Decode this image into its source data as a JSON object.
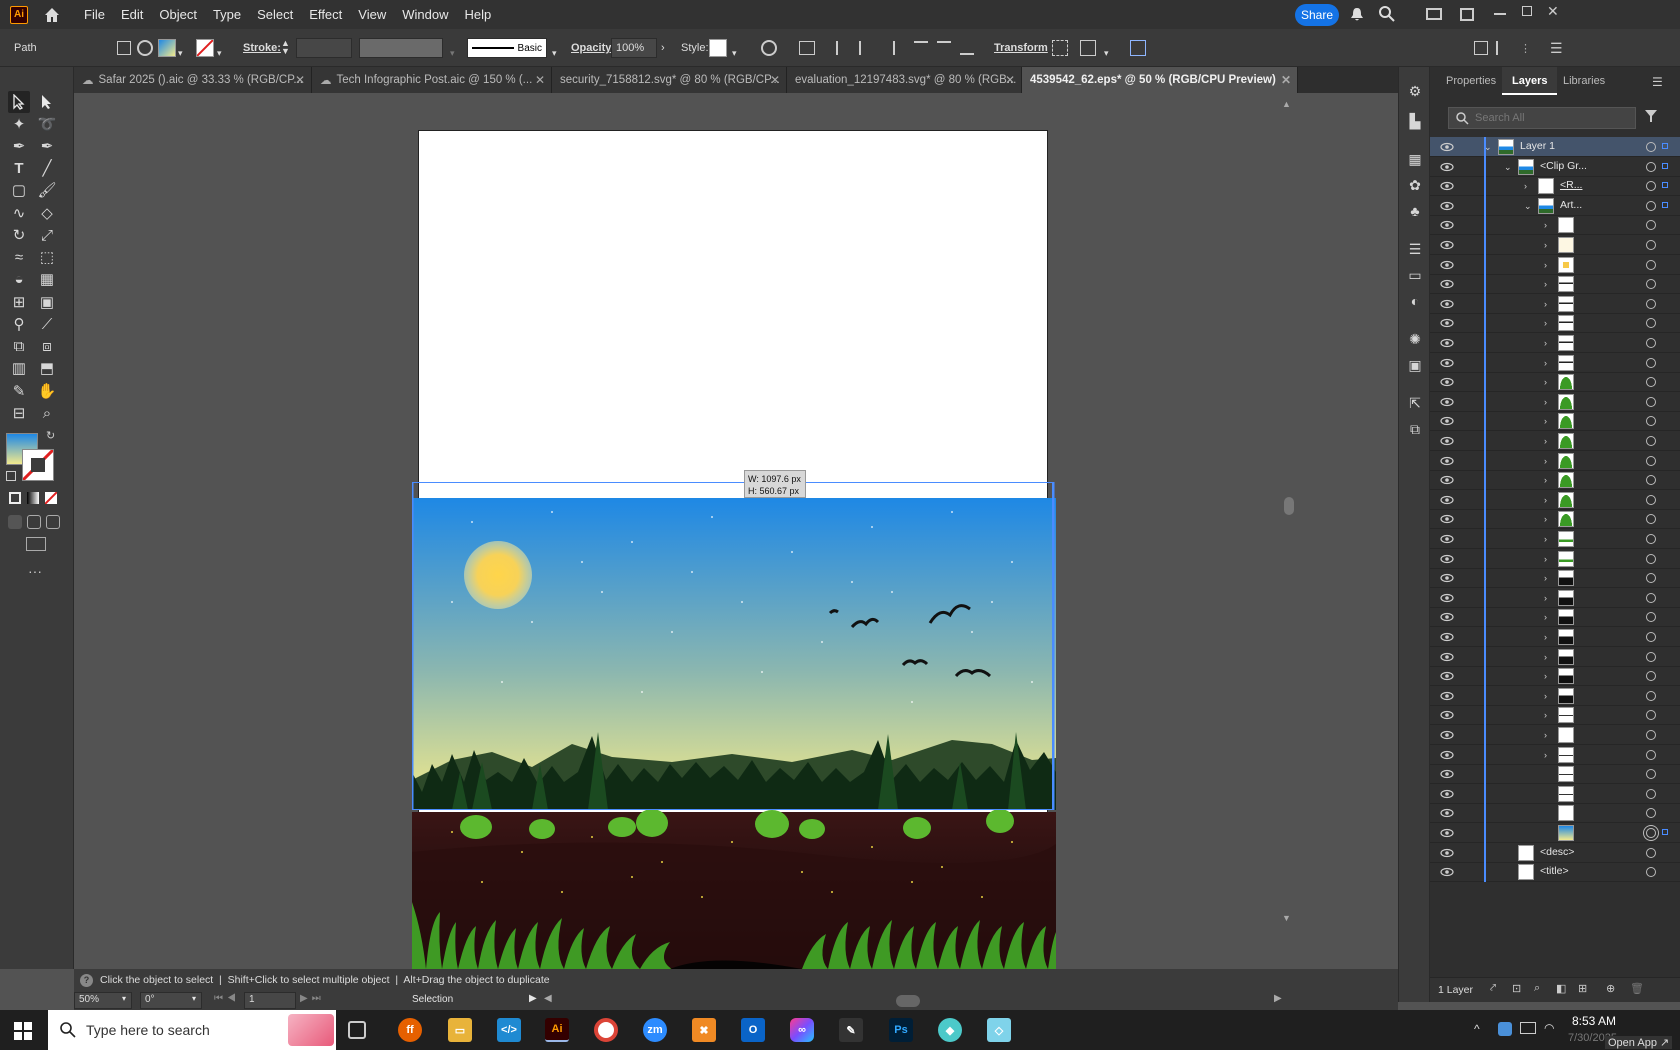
{
  "app": {
    "logo": "Ai",
    "share_label": "Share"
  },
  "menu": [
    "File",
    "Edit",
    "Object",
    "Type",
    "Select",
    "Effect",
    "View",
    "Window",
    "Help"
  ],
  "control": {
    "selection_type": "Path",
    "stroke_label": "Stroke:",
    "brush_label": "Basic",
    "opacity_label": "Opacity:",
    "opacity_value": "100%",
    "style_label": "Style:",
    "transform_label": "Transform"
  },
  "tabs": [
    {
      "label": "Safar 2025 ().aic @ 33.33 % (RGB/CP...",
      "cloud": true
    },
    {
      "label": "Tech Infographic Post.aic @ 150 % (...",
      "cloud": true
    },
    {
      "label": "security_7158812.svg* @ 80 % (RGB/CP..."
    },
    {
      "label": "evaluation_12197483.svg* @ 80 % (RGB..."
    },
    {
      "label": "4539542_62.eps* @ 50 % (RGB/CPU Preview)",
      "active": true
    }
  ],
  "canvas": {
    "dim_w": "W: 1097.6 px",
    "dim_h": "H: 560.67 px",
    "sky_top": "#1e88e5",
    "sky_bottom": "#f3ea8c"
  },
  "panel": {
    "tabs": [
      "Properties",
      "Layers",
      "Libraries"
    ],
    "active_tab": "Layers",
    "search_placeholder": "Search All",
    "layers": [
      {
        "name": "Layer 1",
        "level": 0,
        "thumb": "scene",
        "selected": true
      },
      {
        "name": "<Clip Gr...",
        "level": 1,
        "thumb": "scene"
      },
      {
        "name": "<R...",
        "level": 2,
        "thumb": "white",
        "underline": true
      },
      {
        "name": "Art...",
        "level": 2,
        "thumb": "scene"
      },
      {
        "name": "",
        "level": 3,
        "thumb": "white"
      },
      {
        "name": "",
        "level": 3,
        "thumb": "cream"
      },
      {
        "name": "",
        "level": 3,
        "thumb": "sun"
      },
      {
        "name": "",
        "level": 3,
        "thumb": "wave"
      },
      {
        "name": "",
        "level": 3,
        "thumb": "wave"
      },
      {
        "name": "",
        "level": 3,
        "thumb": "wave"
      },
      {
        "name": "",
        "level": 3,
        "thumb": "wave"
      },
      {
        "name": "",
        "level": 3,
        "thumb": "wave"
      },
      {
        "name": "",
        "level": 3,
        "thumb": "grass"
      },
      {
        "name": "",
        "level": 3,
        "thumb": "grass"
      },
      {
        "name": "",
        "level": 3,
        "thumb": "grass"
      },
      {
        "name": "",
        "level": 3,
        "thumb": "grass"
      },
      {
        "name": "",
        "level": 3,
        "thumb": "grass"
      },
      {
        "name": "",
        "level": 3,
        "thumb": "grass"
      },
      {
        "name": "",
        "level": 3,
        "thumb": "grass"
      },
      {
        "name": "",
        "level": 3,
        "thumb": "grass"
      },
      {
        "name": "",
        "level": 3,
        "thumb": "band"
      },
      {
        "name": "",
        "level": 3,
        "thumb": "band"
      },
      {
        "name": "",
        "level": 3,
        "thumb": "tree"
      },
      {
        "name": "",
        "level": 3,
        "thumb": "tree"
      },
      {
        "name": "",
        "level": 3,
        "thumb": "tree"
      },
      {
        "name": "",
        "level": 3,
        "thumb": "tree"
      },
      {
        "name": "",
        "level": 3,
        "thumb": "tree"
      },
      {
        "name": "",
        "level": 3,
        "thumb": "tree"
      },
      {
        "name": "",
        "level": 3,
        "thumb": "tree"
      },
      {
        "name": "",
        "level": 3,
        "thumb": "line"
      },
      {
        "name": "",
        "level": 3,
        "thumb": "white"
      },
      {
        "name": "",
        "level": 3,
        "thumb": "line"
      },
      {
        "name": "",
        "level": 3,
        "thumb": "line",
        "nochev": true
      },
      {
        "name": "",
        "level": 3,
        "thumb": "line",
        "nochev": true
      },
      {
        "name": "",
        "level": 3,
        "thumb": "white",
        "nochev": true
      },
      {
        "name": "",
        "level": 3,
        "thumb": "sky",
        "nochev": true,
        "target": true
      },
      {
        "name": "<desc>",
        "level": 1,
        "thumb": "white",
        "nochev": true
      },
      {
        "name": "<title>",
        "level": 1,
        "thumb": "white",
        "nochev": true
      }
    ],
    "footer_label": "1 Layer"
  },
  "status": {
    "hint": "Click the object to select  |  Shift+Click to select multiple object  |  Alt+Drag the object to duplicate",
    "zoom": "50%",
    "rotation": "0°",
    "artboard": "1",
    "tool": "Selection"
  },
  "taskbar": {
    "search_placeholder": "Type here to search",
    "time": "8:53 AM",
    "date": "7/30/2025",
    "open_app": "Open App"
  }
}
